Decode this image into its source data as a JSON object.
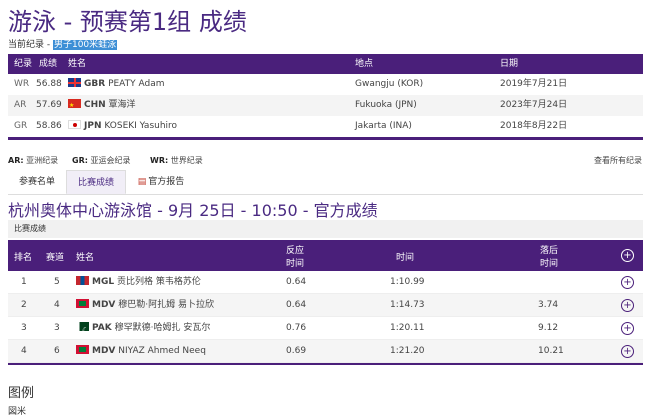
{
  "title": "游泳 - 预赛第1组 成绩",
  "current_record": {
    "label": "当前纪录 -",
    "event": "男子100米蛙泳"
  },
  "records": {
    "headers": [
      "纪录",
      "成绩",
      "姓名",
      "地点",
      "日期"
    ],
    "rows": [
      {
        "type": "WR",
        "time": "56.88",
        "flag": "gbr",
        "noc": "GBR",
        "name": "PEATY Adam",
        "place": "Gwangju (KOR)",
        "date": "2019年7月21日"
      },
      {
        "type": "AR",
        "time": "57.69",
        "flag": "chn",
        "noc": "CHN",
        "name": "覃海洋",
        "place": "Fukuoka (JPN)",
        "date": "2023年7月24日"
      },
      {
        "type": "GR",
        "time": "58.86",
        "flag": "jpn",
        "noc": "JPN",
        "name": "KOSEKI Yasuhiro",
        "place": "Jakarta (INA)",
        "date": "2018年8月22日"
      }
    ]
  },
  "legend": {
    "ar": "AR:",
    "ar_text": "亚洲纪录",
    "gr": "GR:",
    "gr_text": "亚运会纪录",
    "wr": "WR:",
    "wr_text": "世界纪录",
    "view_all": "查看所有纪录"
  },
  "tabs": {
    "start_list": "参赛名单",
    "results": "比赛成绩",
    "report": "官方报告"
  },
  "venue": "杭州奥体中心游泳馆 - 9月 25日 - 10:50 - 官方成绩",
  "section_label": "比赛成绩",
  "results": {
    "headers": {
      "rank": "排名",
      "lane": "赛道",
      "name": "姓名",
      "reaction_1": "反应",
      "reaction_2": "时间",
      "time": "时间",
      "behind_1": "落后",
      "behind_2": "时间"
    },
    "rows": [
      {
        "rank": "1",
        "lane": "5",
        "flag": "mgl",
        "noc": "MGL",
        "name": "贡比列格 策韦格苏伦",
        "reaction": "0.64",
        "time": "1:10.99",
        "behind": ""
      },
      {
        "rank": "2",
        "lane": "4",
        "flag": "mdv",
        "noc": "MDV",
        "name": "穆巴勒·阿扎姆 易卜拉欣",
        "reaction": "0.64",
        "time": "1:14.73",
        "behind": "3.74"
      },
      {
        "rank": "3",
        "lane": "3",
        "flag": "pak",
        "noc": "PAK",
        "name": "穆罕默德·哈姆扎 安瓦尔",
        "reaction": "0.76",
        "time": "1:20.11",
        "behind": "9.12"
      },
      {
        "rank": "4",
        "lane": "6",
        "flag": "mdv",
        "noc": "MDV",
        "name": "NIYAZ Ahmed Neeq",
        "reaction": "0.69",
        "time": "1:21.20",
        "behind": "10.21"
      }
    ]
  },
  "legend_section": {
    "title": "图例",
    "sub": "図米"
  },
  "colors": {
    "header_purple": "#4a1f7a",
    "title_purple": "#4a2a82",
    "highlight_blue": "#3d8fd6"
  }
}
